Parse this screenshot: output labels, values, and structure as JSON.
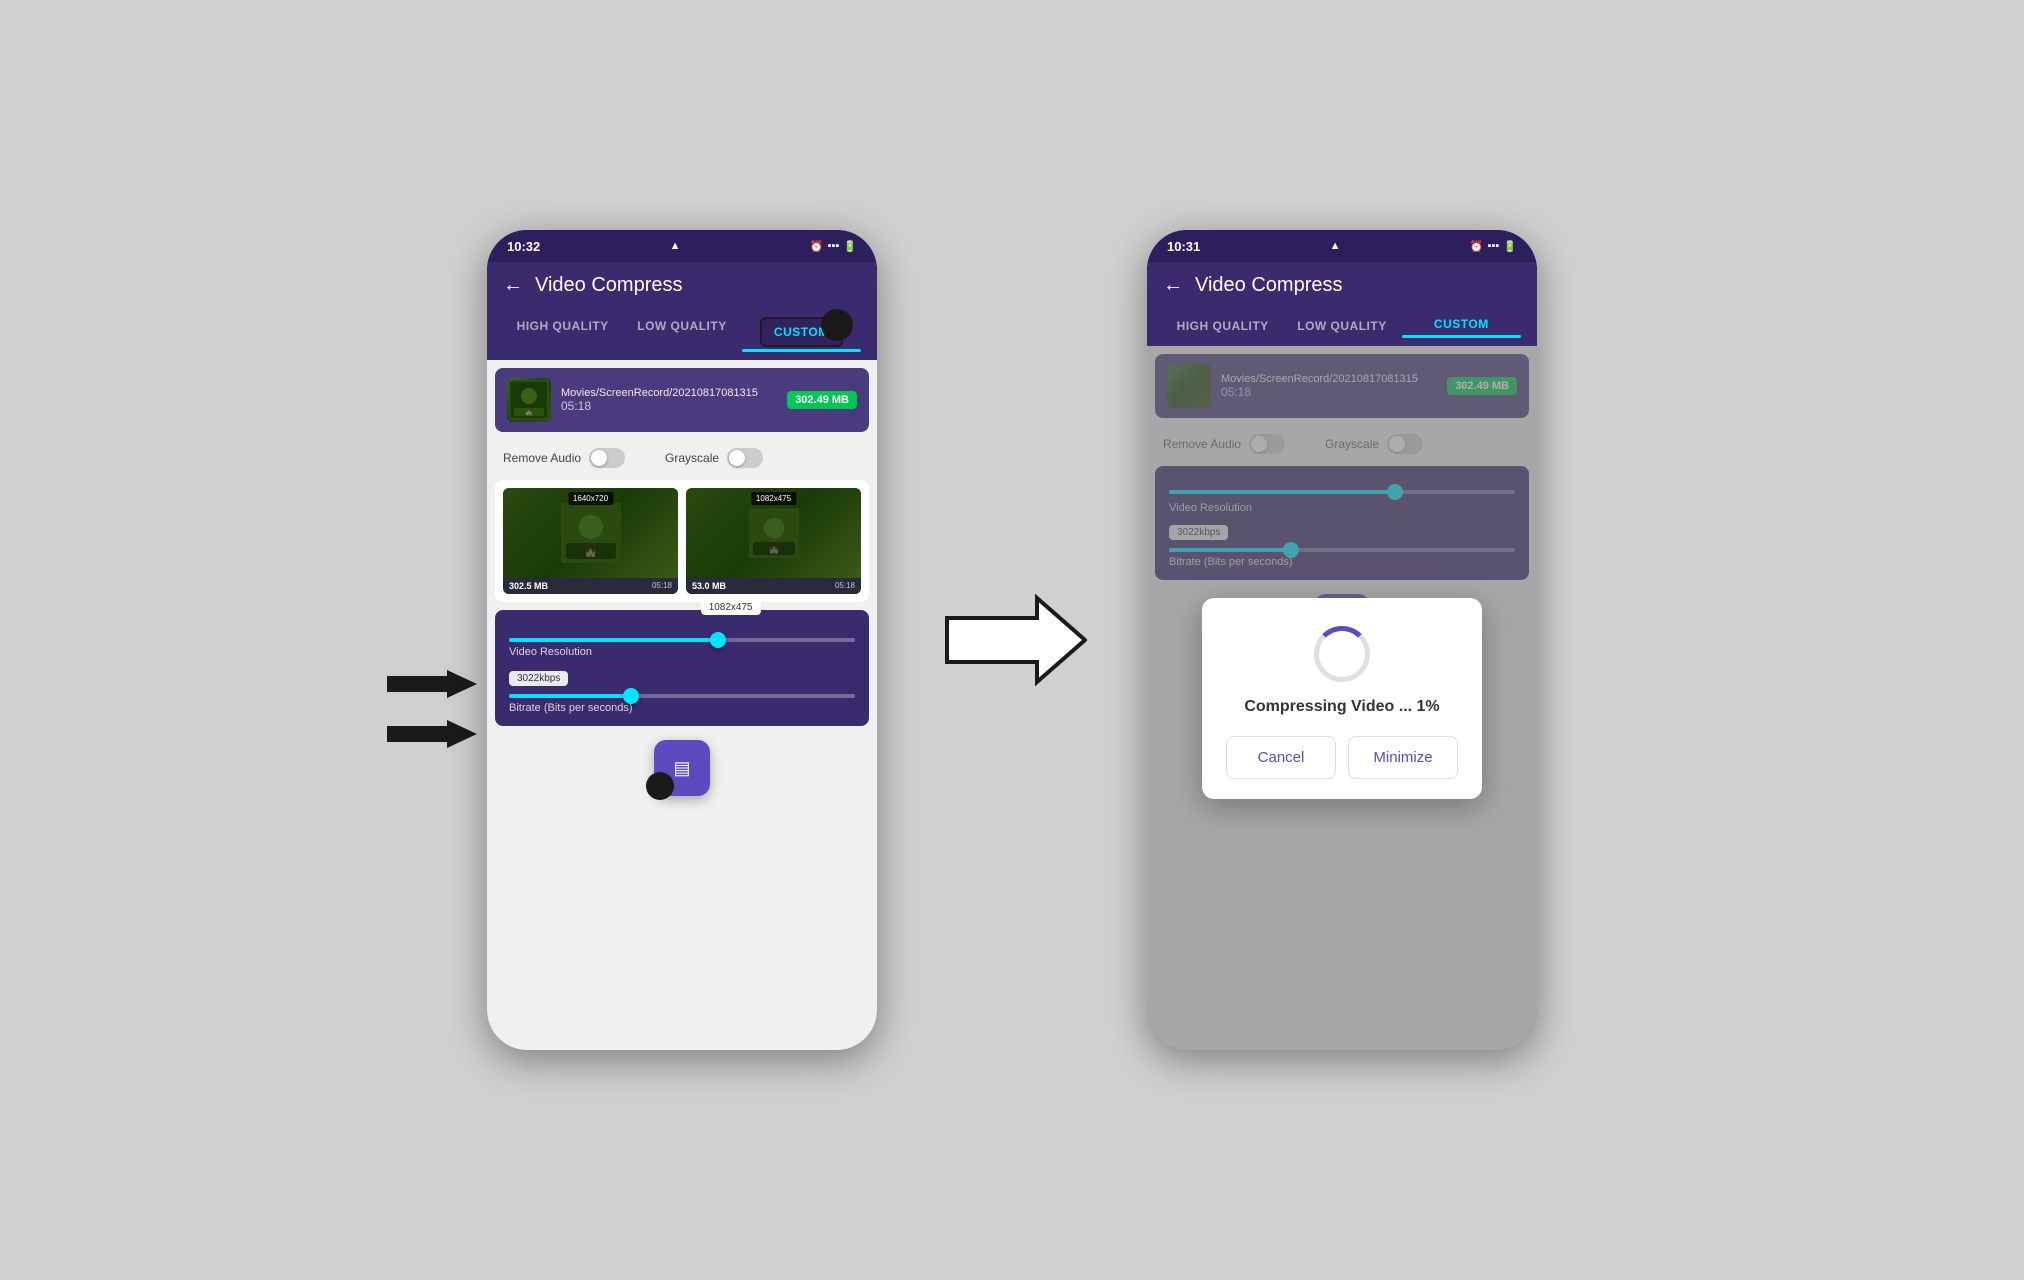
{
  "left_phone": {
    "status": {
      "time": "10:32",
      "warning": "▲",
      "icons": "⏰ .ill 📶"
    },
    "header": {
      "back_label": "←",
      "title": "Video Compress"
    },
    "tabs": [
      {
        "label": "HIGH QUALITY",
        "active": false
      },
      {
        "label": "LOW QUALITY",
        "active": false
      },
      {
        "label": "CUSTOM",
        "active": true
      }
    ],
    "file": {
      "path": "Movies/ScreenRecord/20210817081315",
      "duration": "05:18",
      "size": "302.49 MB"
    },
    "toggles": {
      "remove_audio": "Remove Audio",
      "grayscale": "Grayscale"
    },
    "video_compare": {
      "original": {
        "resolution": "1640x720",
        "size": "302.5 MB",
        "duration": "05:18"
      },
      "compressed": {
        "resolution": "1082x475",
        "size": "53.0 MB",
        "duration": "05:18"
      }
    },
    "controls": {
      "resolution_badge": "1082x475",
      "resolution_label": "Video Resolution",
      "bitrate_value": "3022kbps",
      "bitrate_label": "Bitrate (Bits per seconds)",
      "slider1_fill": "60",
      "slider2_fill": "35"
    },
    "fab": {
      "icon": "⬛"
    }
  },
  "right_phone": {
    "status": {
      "time": "10:31",
      "warning": "▲",
      "icons": "⏰ .ill 📶"
    },
    "header": {
      "back_label": "←",
      "title": "Video Compress"
    },
    "tabs": [
      {
        "label": "HIGH QUALITY",
        "active": false
      },
      {
        "label": "LOW QUALITY",
        "active": false
      },
      {
        "label": "CUSTOM",
        "active": true
      }
    ],
    "file": {
      "path": "Movies/ScreenRecord/20210817081315",
      "duration": "05:18",
      "size": "302.49 MB"
    },
    "toggles": {
      "remove_audio": "Remove Audio",
      "grayscale": "Grayscale"
    },
    "controls": {
      "resolution_label": "Video Resolution",
      "bitrate_value": "3022kbps",
      "bitrate_label": "Bitrate (Bits per seconds)"
    },
    "dialog": {
      "title": "Compressing Video ... 1%",
      "cancel_label": "Cancel",
      "minimize_label": "Minimize"
    },
    "fab": {
      "icon": "⬛"
    }
  },
  "arrow": {
    "symbol": "→"
  }
}
